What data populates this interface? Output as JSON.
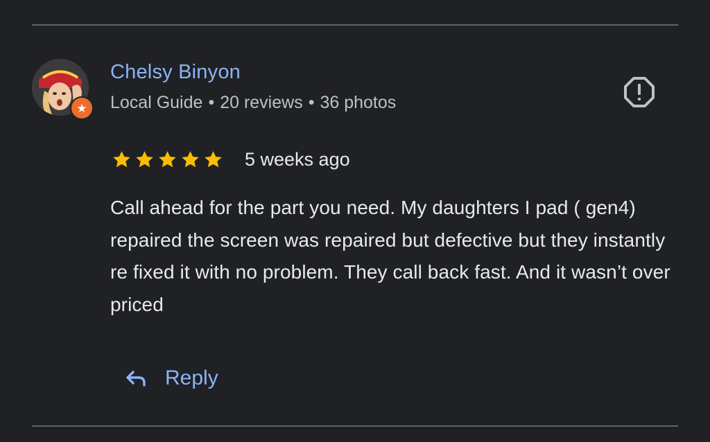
{
  "review": {
    "author": {
      "name": "Chelsy Binyon",
      "badge_icon": "star-badge-icon",
      "role": "Local Guide",
      "reviews": "20 reviews",
      "photos": "36 photos"
    },
    "rating": 5,
    "max_rating": 5,
    "date": "5 weeks ago",
    "text": "Call ahead for the part you need. My daughters I pad ( gen4) repaired the screen was repaired but defective but they instantly re fixed it with no problem. They call back fast. And it wasn’t over priced",
    "actions": {
      "reply_label": "Reply",
      "reply_icon": "reply-arrow-icon",
      "report_icon": "report-octagon-icon"
    }
  },
  "colors": {
    "background": "#202124",
    "link": "#8ab4f8",
    "star": "#fbbc04",
    "muted_text": "#bdc1c6",
    "text": "#e8eaed",
    "divider": "#5f6368",
    "guide_badge": "#ed6d2b"
  }
}
